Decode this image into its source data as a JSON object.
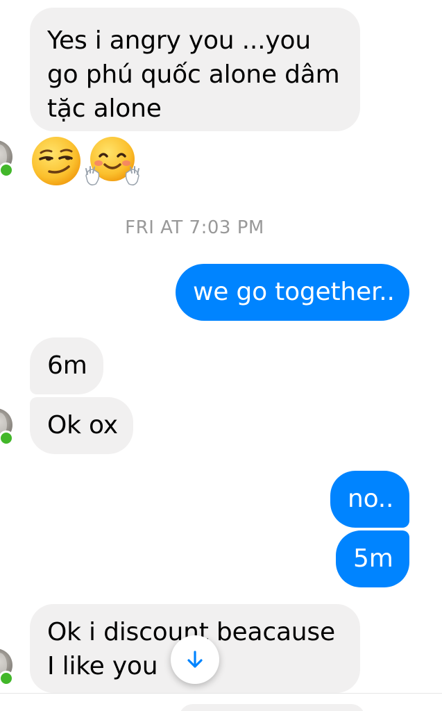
{
  "messages": {
    "m1": "Yes i angry you ...you\ngo phú quốc alone dâm\ntặc alone",
    "m2": "we go together..",
    "m3": "6m",
    "m4": "Ok ox",
    "m5": "no..",
    "m6": "5m",
    "m7": "Ok i discount beacause\nI like you"
  },
  "timestamp": "FRI AT 7:03 PM",
  "emojis": [
    "smirking-face",
    "hugging-face"
  ],
  "colors": {
    "incoming_bubble": "#f1f0f0",
    "outgoing_bubble": "#0084ff",
    "online": "#42b72a",
    "timestamp": "#999999",
    "scroll_arrow": "#0084ff"
  }
}
